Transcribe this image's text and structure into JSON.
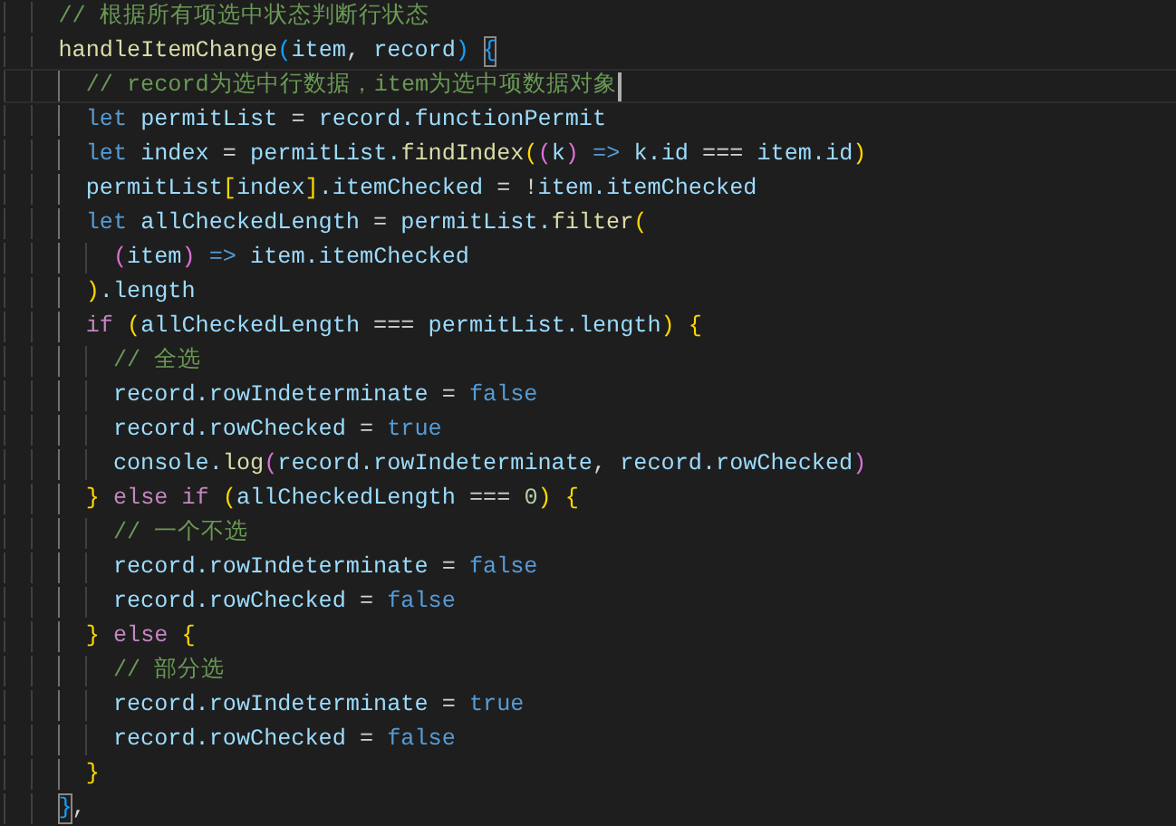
{
  "editor": {
    "lines": [
      {
        "current": false,
        "tokens": [
          {
            "kind": "comment",
            "text": "// 根据所有项选中状态判断行状态"
          }
        ]
      },
      {
        "current": false,
        "tokens": [
          {
            "kind": "fn",
            "text": "handleItemChange"
          },
          {
            "kind": "b3",
            "text": "("
          },
          {
            "kind": "var",
            "text": "item"
          },
          {
            "kind": "punct",
            "text": ", "
          },
          {
            "kind": "var",
            "text": "record"
          },
          {
            "kind": "b3",
            "text": ") "
          },
          {
            "kind": "b3match",
            "text": "{"
          }
        ],
        "children": [
          {
            "current": true,
            "tokens": [
              {
                "kind": "comment",
                "text": "// record为选中行数据，item为选中项数据对象"
              }
            ]
          },
          {
            "current": false,
            "tokens": [
              {
                "kind": "keyword",
                "text": "let "
              },
              {
                "kind": "var",
                "text": "permitList"
              },
              {
                "kind": "punct",
                "text": " = "
              },
              {
                "kind": "var",
                "text": "record.functionPermit"
              }
            ]
          },
          {
            "current": false,
            "tokens": [
              {
                "kind": "keyword",
                "text": "let "
              },
              {
                "kind": "var",
                "text": "index"
              },
              {
                "kind": "punct",
                "text": " = "
              },
              {
                "kind": "var",
                "text": "permitList."
              },
              {
                "kind": "fn",
                "text": "findIndex"
              },
              {
                "kind": "b1",
                "text": "("
              },
              {
                "kind": "b2",
                "text": "("
              },
              {
                "kind": "var",
                "text": "k"
              },
              {
                "kind": "b2",
                "text": ") "
              },
              {
                "kind": "keyword",
                "text": "=> "
              },
              {
                "kind": "var",
                "text": "k.id"
              },
              {
                "kind": "punct",
                "text": " === "
              },
              {
                "kind": "var",
                "text": "item.id"
              },
              {
                "kind": "b1",
                "text": ")"
              }
            ]
          },
          {
            "current": false,
            "tokens": [
              {
                "kind": "var",
                "text": "permitList"
              },
              {
                "kind": "b1",
                "text": "["
              },
              {
                "kind": "var",
                "text": "index"
              },
              {
                "kind": "b1",
                "text": "]"
              },
              {
                "kind": "var",
                "text": ".itemChecked"
              },
              {
                "kind": "punct",
                "text": " = !"
              },
              {
                "kind": "var",
                "text": "item.itemChecked"
              }
            ]
          },
          {
            "current": false,
            "tokens": [
              {
                "kind": "keyword",
                "text": "let "
              },
              {
                "kind": "var",
                "text": "allCheckedLength"
              },
              {
                "kind": "punct",
                "text": " = "
              },
              {
                "kind": "var",
                "text": "permitList."
              },
              {
                "kind": "fn",
                "text": "filter"
              },
              {
                "kind": "b1",
                "text": "("
              }
            ],
            "children": [
              {
                "current": false,
                "tokens": [
                  {
                    "kind": "b2",
                    "text": "("
                  },
                  {
                    "kind": "var",
                    "text": "item"
                  },
                  {
                    "kind": "b2",
                    "text": ") "
                  },
                  {
                    "kind": "keyword",
                    "text": "=> "
                  },
                  {
                    "kind": "var",
                    "text": "item.itemChecked"
                  }
                ]
              }
            ]
          },
          {
            "current": false,
            "tokens": [
              {
                "kind": "b1",
                "text": ")"
              },
              {
                "kind": "var",
                "text": ".length"
              }
            ]
          },
          {
            "current": false,
            "tokens": [
              {
                "kind": "control",
                "text": "if "
              },
              {
                "kind": "b1",
                "text": "("
              },
              {
                "kind": "var",
                "text": "allCheckedLength"
              },
              {
                "kind": "punct",
                "text": " === "
              },
              {
                "kind": "var",
                "text": "permitList.length"
              },
              {
                "kind": "b1",
                "text": ") {"
              }
            ],
            "children": [
              {
                "current": false,
                "tokens": [
                  {
                    "kind": "comment",
                    "text": "// 全选"
                  }
                ]
              },
              {
                "current": false,
                "tokens": [
                  {
                    "kind": "var",
                    "text": "record.rowIndeterminate"
                  },
                  {
                    "kind": "punct",
                    "text": " = "
                  },
                  {
                    "kind": "bool",
                    "text": "false"
                  }
                ]
              },
              {
                "current": false,
                "tokens": [
                  {
                    "kind": "var",
                    "text": "record.rowChecked"
                  },
                  {
                    "kind": "punct",
                    "text": " = "
                  },
                  {
                    "kind": "bool",
                    "text": "true"
                  }
                ]
              },
              {
                "current": false,
                "tokens": [
                  {
                    "kind": "var",
                    "text": "console."
                  },
                  {
                    "kind": "fn",
                    "text": "log"
                  },
                  {
                    "kind": "b2",
                    "text": "("
                  },
                  {
                    "kind": "var",
                    "text": "record.rowIndeterminate"
                  },
                  {
                    "kind": "punct",
                    "text": ", "
                  },
                  {
                    "kind": "var",
                    "text": "record.rowChecked"
                  },
                  {
                    "kind": "b2",
                    "text": ")"
                  }
                ]
              }
            ]
          },
          {
            "current": false,
            "tokens": [
              {
                "kind": "b1",
                "text": "} "
              },
              {
                "kind": "control",
                "text": "else if "
              },
              {
                "kind": "b1",
                "text": "("
              },
              {
                "kind": "var",
                "text": "allCheckedLength"
              },
              {
                "kind": "punct",
                "text": " === "
              },
              {
                "kind": "num",
                "text": "0"
              },
              {
                "kind": "b1",
                "text": ") {"
              }
            ],
            "children": [
              {
                "current": false,
                "tokens": [
                  {
                    "kind": "comment",
                    "text": "// 一个不选"
                  }
                ]
              },
              {
                "current": false,
                "tokens": [
                  {
                    "kind": "var",
                    "text": "record.rowIndeterminate"
                  },
                  {
                    "kind": "punct",
                    "text": " = "
                  },
                  {
                    "kind": "bool",
                    "text": "false"
                  }
                ]
              },
              {
                "current": false,
                "tokens": [
                  {
                    "kind": "var",
                    "text": "record.rowChecked"
                  },
                  {
                    "kind": "punct",
                    "text": " = "
                  },
                  {
                    "kind": "bool",
                    "text": "false"
                  }
                ]
              }
            ]
          },
          {
            "current": false,
            "tokens": [
              {
                "kind": "b1",
                "text": "} "
              },
              {
                "kind": "control",
                "text": "else "
              },
              {
                "kind": "b1",
                "text": "{"
              }
            ],
            "children": [
              {
                "current": false,
                "tokens": [
                  {
                    "kind": "comment",
                    "text": "// 部分选"
                  }
                ]
              },
              {
                "current": false,
                "tokens": [
                  {
                    "kind": "var",
                    "text": "record.rowIndeterminate"
                  },
                  {
                    "kind": "punct",
                    "text": " = "
                  },
                  {
                    "kind": "bool",
                    "text": "true"
                  }
                ]
              },
              {
                "current": false,
                "tokens": [
                  {
                    "kind": "var",
                    "text": "record.rowChecked"
                  },
                  {
                    "kind": "punct",
                    "text": " = "
                  },
                  {
                    "kind": "bool",
                    "text": "false"
                  }
                ]
              }
            ]
          },
          {
            "current": false,
            "tokens": [
              {
                "kind": "b1",
                "text": "}"
              }
            ]
          }
        ]
      },
      {
        "current": false,
        "tokens": [
          {
            "kind": "b3match",
            "text": "}"
          },
          {
            "kind": "punct",
            "text": ","
          }
        ]
      }
    ]
  }
}
